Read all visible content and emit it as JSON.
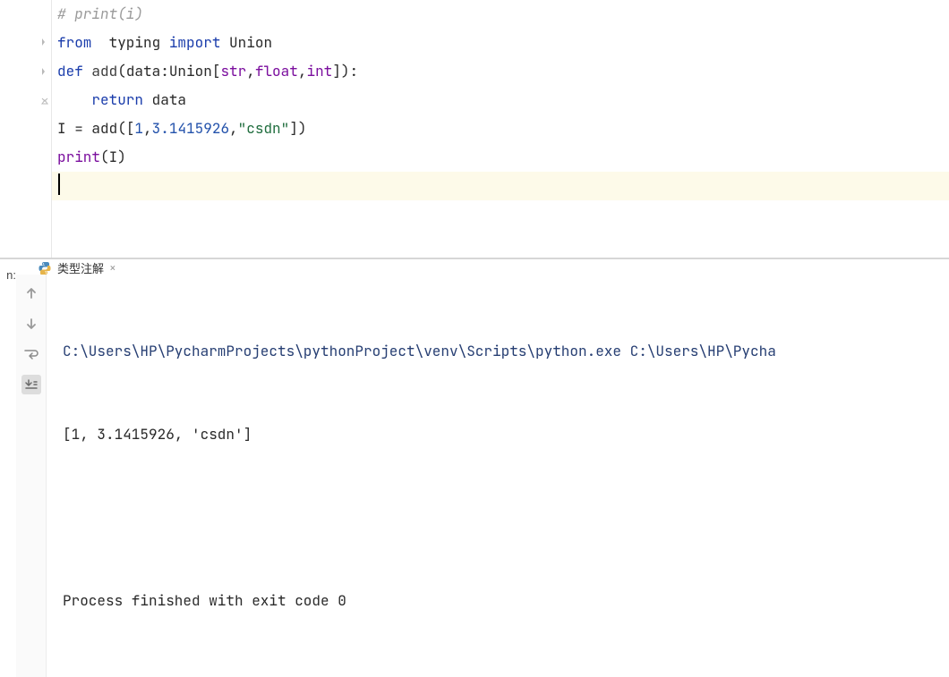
{
  "code": {
    "lines": [
      {
        "type": "comment",
        "text": "# print(i)"
      },
      {
        "type": "import",
        "kw1": "from",
        "sp1": "  ",
        "mod": "typing",
        "kw2": "import",
        "name": "Union"
      },
      {
        "type": "def",
        "kw": "def",
        "fname": "add",
        "p1": "(data:Union[",
        "t1": "str",
        "c1": ",",
        "t2": "float",
        "c2": ",",
        "t3": "int",
        "p2": "]):"
      },
      {
        "type": "return",
        "indent": "    ",
        "kw": "return",
        "expr": "data"
      },
      {
        "type": "assign",
        "var": "I = add(",
        "b1": "[",
        "n1": "1",
        "c1": ",",
        "n2": "3.1415926",
        "c2": ",",
        "s1": "\"csdn\"",
        "b2": "]",
        "p2": ")"
      },
      {
        "type": "call",
        "fn": "print",
        "arg": "(I)"
      }
    ]
  },
  "run": {
    "label": "n:",
    "tab_name": "类型注解",
    "console": {
      "cmd": "C:\\Users\\HP\\PycharmProjects\\pythonProject\\venv\\Scripts\\python.exe C:\\Users\\HP\\Pycha",
      "output": "[1, 3.1415926, 'csdn']",
      "exit": "Process finished with exit code 0"
    }
  }
}
